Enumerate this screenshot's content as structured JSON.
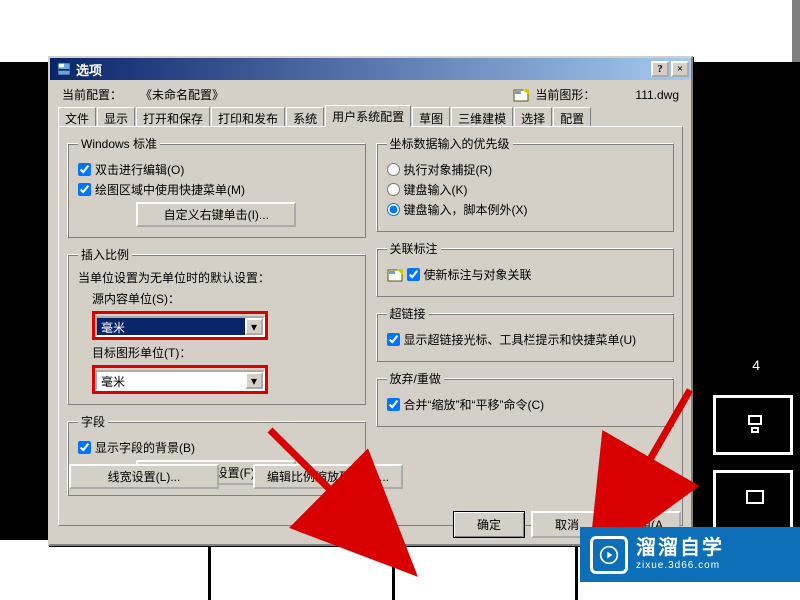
{
  "window": {
    "title": "选项",
    "help": "?",
    "close": "×"
  },
  "profile": {
    "current_label": "当前配置：",
    "current_value": "《未命名配置》",
    "drawing_label": "当前图形：",
    "drawing_value": "111.dwg"
  },
  "tabs": [
    "文件",
    "显示",
    "打开和保存",
    "打印和发布",
    "系统",
    "用户系统配置",
    "草图",
    "三维建模",
    "选择",
    "配置"
  ],
  "active_tab_index": 5,
  "left": {
    "winstd": {
      "legend": "Windows 标准",
      "dblclick": "双击进行编辑(O)",
      "shortcut": "绘图区域中使用快捷菜单(M)",
      "button": "自定义右键单击(I)..."
    },
    "insert": {
      "legend": "插入比例",
      "desc": "当单位设置为无单位时的默认设置：",
      "src_label": "源内容单位(S)：",
      "src_value": "毫米",
      "tgt_label": "目标图形单位(T)：",
      "tgt_value": "毫米"
    },
    "field": {
      "legend": "字段",
      "show": "显示字段的背景(B)",
      "button": "字段更新设置(F)..."
    }
  },
  "right": {
    "priority": {
      "legend": "坐标数据输入的优先级",
      "r1": "执行对象捕捉(R)",
      "r2": "键盘输入(K)",
      "r3": "键盘输入，脚本例外(X)"
    },
    "dim": {
      "legend": "关联标注",
      "cb": "使新标注与对象关联"
    },
    "hlink": {
      "legend": "超链接",
      "cb": "显示超链接光标、工具栏提示和快捷菜单(U)"
    },
    "undo": {
      "legend": "放弃/重做",
      "cb": "合并“缩放”和“平移”命令(C)"
    }
  },
  "lower": {
    "lineweight": "线宽设置(L)...",
    "editscale": "编辑比例缩放列表(E)..."
  },
  "footer": {
    "ok": "确定",
    "cancel": "取消",
    "apply": "应用(A"
  },
  "brand": {
    "cn": "溜溜自学",
    "url": "zixue.3d66.com"
  },
  "rnum": "4"
}
